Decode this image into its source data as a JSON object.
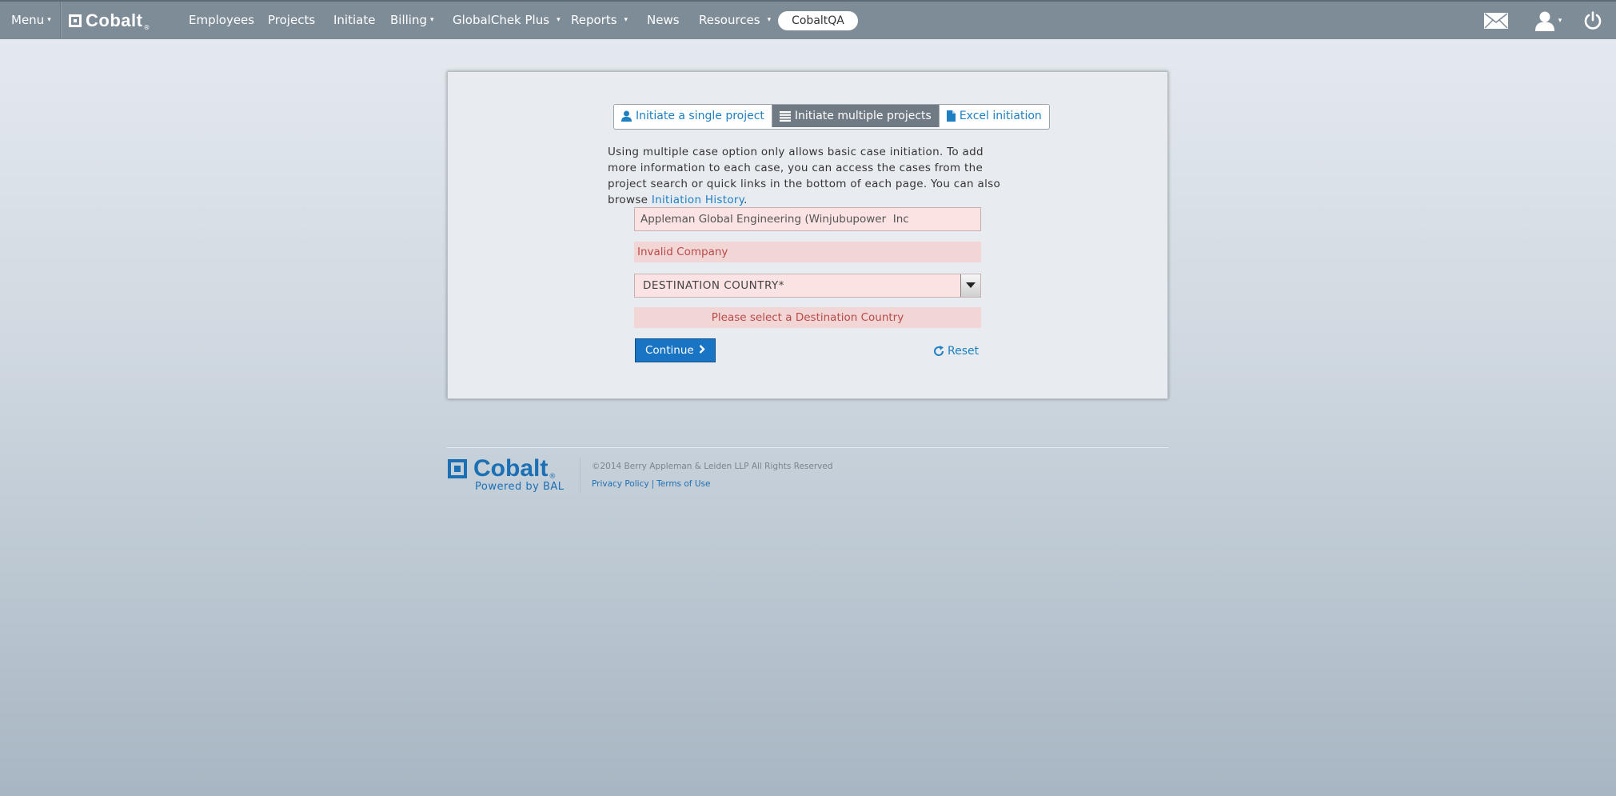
{
  "nav": {
    "menu_label": "Menu",
    "brand": "Cobalt",
    "brand_mark": "®",
    "items": [
      {
        "label": "Employees"
      },
      {
        "label": "Projects"
      },
      {
        "label": "Initiate"
      },
      {
        "label": "Billing"
      },
      {
        "label": "GlobalChek Plus"
      },
      {
        "label": "Reports"
      },
      {
        "label": "News"
      },
      {
        "label": "Resources"
      }
    ],
    "environment": "CobaltQA",
    "icons": [
      "envelope-icon",
      "user-icon",
      "power-icon"
    ]
  },
  "tabs": [
    {
      "label": "Initiate a single project",
      "icon": "user-icon"
    },
    {
      "label": "Initiate multiple projects",
      "icon": "list-icon"
    },
    {
      "label": "Excel initiation",
      "icon": "document-icon"
    }
  ],
  "description": {
    "text": "Using multiple case option only allows basic case initiation. To add more information to each case, you can access the cases from the project search or quick links in the bottom of each page. You can also browse ",
    "link": "Initiation History",
    "suffix": "."
  },
  "form": {
    "company_value": "Appleman Global Engineering (Winjubupower  Inc",
    "company_error": "Invalid Company",
    "country_selected": "DESTINATION COUNTRY*",
    "country_error": "Please select a Destination Country",
    "continue_label": "Continue",
    "reset_label": "Reset"
  },
  "footer": {
    "brand": "Cobalt",
    "brand_mark": "®",
    "tagline": "Powered by BAL",
    "copyright": "©2014 Berry Appleman & Leiden LLP All Rights Reserved",
    "privacy": "Privacy Policy",
    "link_separator": "|",
    "terms": "Terms of Use"
  },
  "colors": {
    "nav_bg": "#7e8c98",
    "accent": "#1e7fc2",
    "error_bg": "#f2d6d6",
    "error_text": "#b94a48",
    "button": "#1a74c4"
  }
}
